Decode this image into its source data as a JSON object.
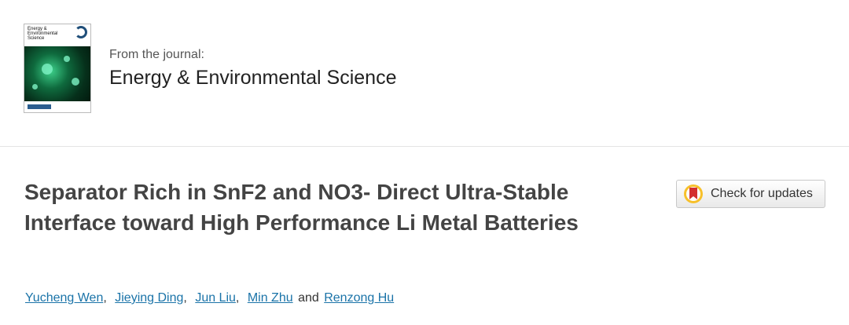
{
  "journal": {
    "cover_title_lines": [
      "Energy &",
      "Environmental",
      "Science"
    ],
    "from_label": "From the journal:",
    "title": "Energy & Environmental Science"
  },
  "article": {
    "title": "Separator Rich in SnF2 and NO3- Direct Ultra-Stable Interface toward High Performance Li Metal Batteries",
    "update_button_label": "Check for updates",
    "authors": [
      "Yucheng Wen",
      "Jieying Ding",
      "Jun Liu",
      "Min Zhu",
      "Renzong Hu"
    ],
    "separators": [
      ",",
      ",",
      ",",
      "and"
    ]
  },
  "colors": {
    "link": "#1a73a8",
    "title_text": "#444444",
    "update_icon_red": "#d32f2f",
    "update_icon_yellow": "#f7c02a"
  },
  "icons": {
    "cover": "journal-cover-image",
    "update": "crossmark-bookmark-icon"
  }
}
